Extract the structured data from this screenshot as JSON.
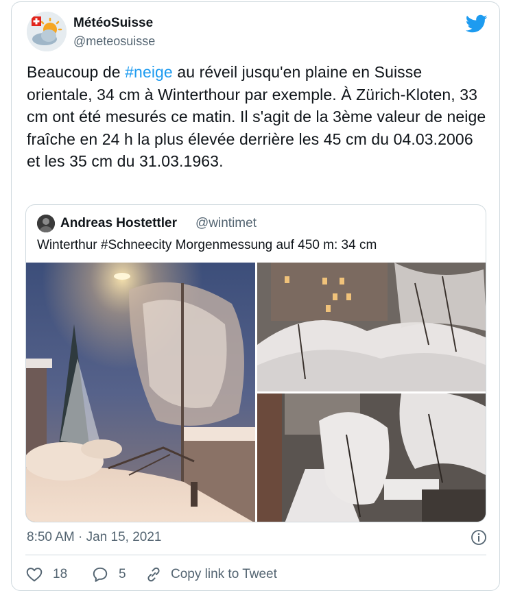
{
  "author": {
    "name": "MétéoSuisse",
    "handle": "@meteosuisse"
  },
  "tweet": {
    "text_before": "Beaucoup de ",
    "hashtag": "#neige",
    "text_after": " au réveil jusqu'en plaine en Suisse orientale, 34 cm à Winterthour par exemple. À Zürich-Kloten, 33 cm ont été mesurés ce matin. Il s'agit de la 3ème valeur de neige fraîche en 24 h la plus élevée derrière les 45 cm du 04.03.2006 et les 35 cm du 31.03.1963."
  },
  "quoted": {
    "name": "Andreas Hostettler",
    "handle": "@wintimet",
    "text": "Winterthur #Schneecity  Morgenmessung auf 450 m: 34 cm"
  },
  "meta": {
    "timestamp": "8:50 AM · Jan 15, 2021"
  },
  "actions": {
    "likes": "18",
    "replies": "5",
    "copy_link": "Copy link to Tweet"
  },
  "icons": {
    "brand": "twitter-bird-icon",
    "info": "info-icon",
    "like": "heart-icon",
    "reply": "reply-bubble-icon",
    "copy": "link-icon"
  },
  "colors": {
    "accent": "#1d9bf0",
    "text": "#0f1419",
    "muted": "#536471",
    "border": "#cfd9de"
  }
}
